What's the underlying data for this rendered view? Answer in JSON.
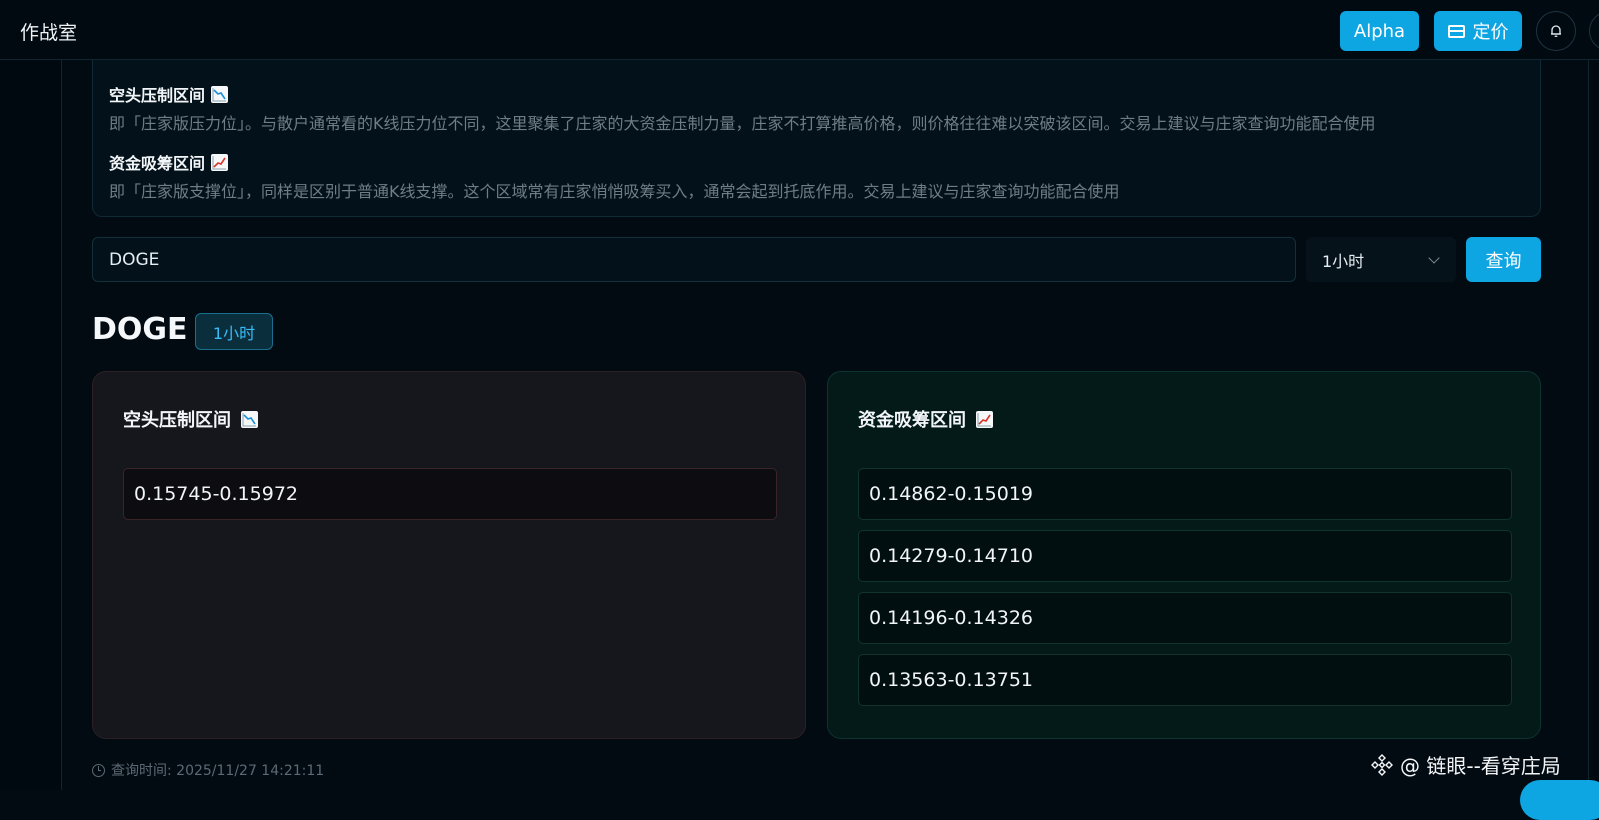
{
  "header": {
    "app_title": "作战室",
    "alpha_label": "Alpha",
    "pricing_label": "定价"
  },
  "info": {
    "short_title": "空头压制区间",
    "short_desc": "即「庄家版压力位」。与散户通常看的K线压力位不同，这里聚集了庄家的大资金压制力量，庄家不打算推高价格，则价格往往难以突破该区间。交易上建议与庄家查询功能配合使用",
    "long_title": "资金吸筹区间",
    "long_desc": "即「庄家版支撑位」，同样是区别于普通K线支撑。这个区域常有庄家悄悄吸筹买入，通常会起到托底作用。交易上建议与庄家查询功能配合使用"
  },
  "search": {
    "symbol_value": "DOGE",
    "interval_value": "1小时",
    "query_label": "查询"
  },
  "result": {
    "symbol": "DOGE",
    "interval_badge": "1小时",
    "short_panel": {
      "title": "空头压制区间",
      "ranges": [
        "0.15745-0.15972"
      ]
    },
    "long_panel": {
      "title": "资金吸筹区间",
      "ranges": [
        "0.14862-0.15019",
        "0.14279-0.14710",
        "0.14196-0.14326",
        "0.13563-0.13751"
      ]
    },
    "query_time": "查询时间: 2025/11/27 14:21:11"
  },
  "watermark": {
    "text": "@ 链眼--看穿庄局"
  },
  "colors": {
    "accent": "#0ea5e3",
    "background": "#020b12",
    "short_panel_bg": "#16161d",
    "long_panel_bg": "#031a19"
  }
}
